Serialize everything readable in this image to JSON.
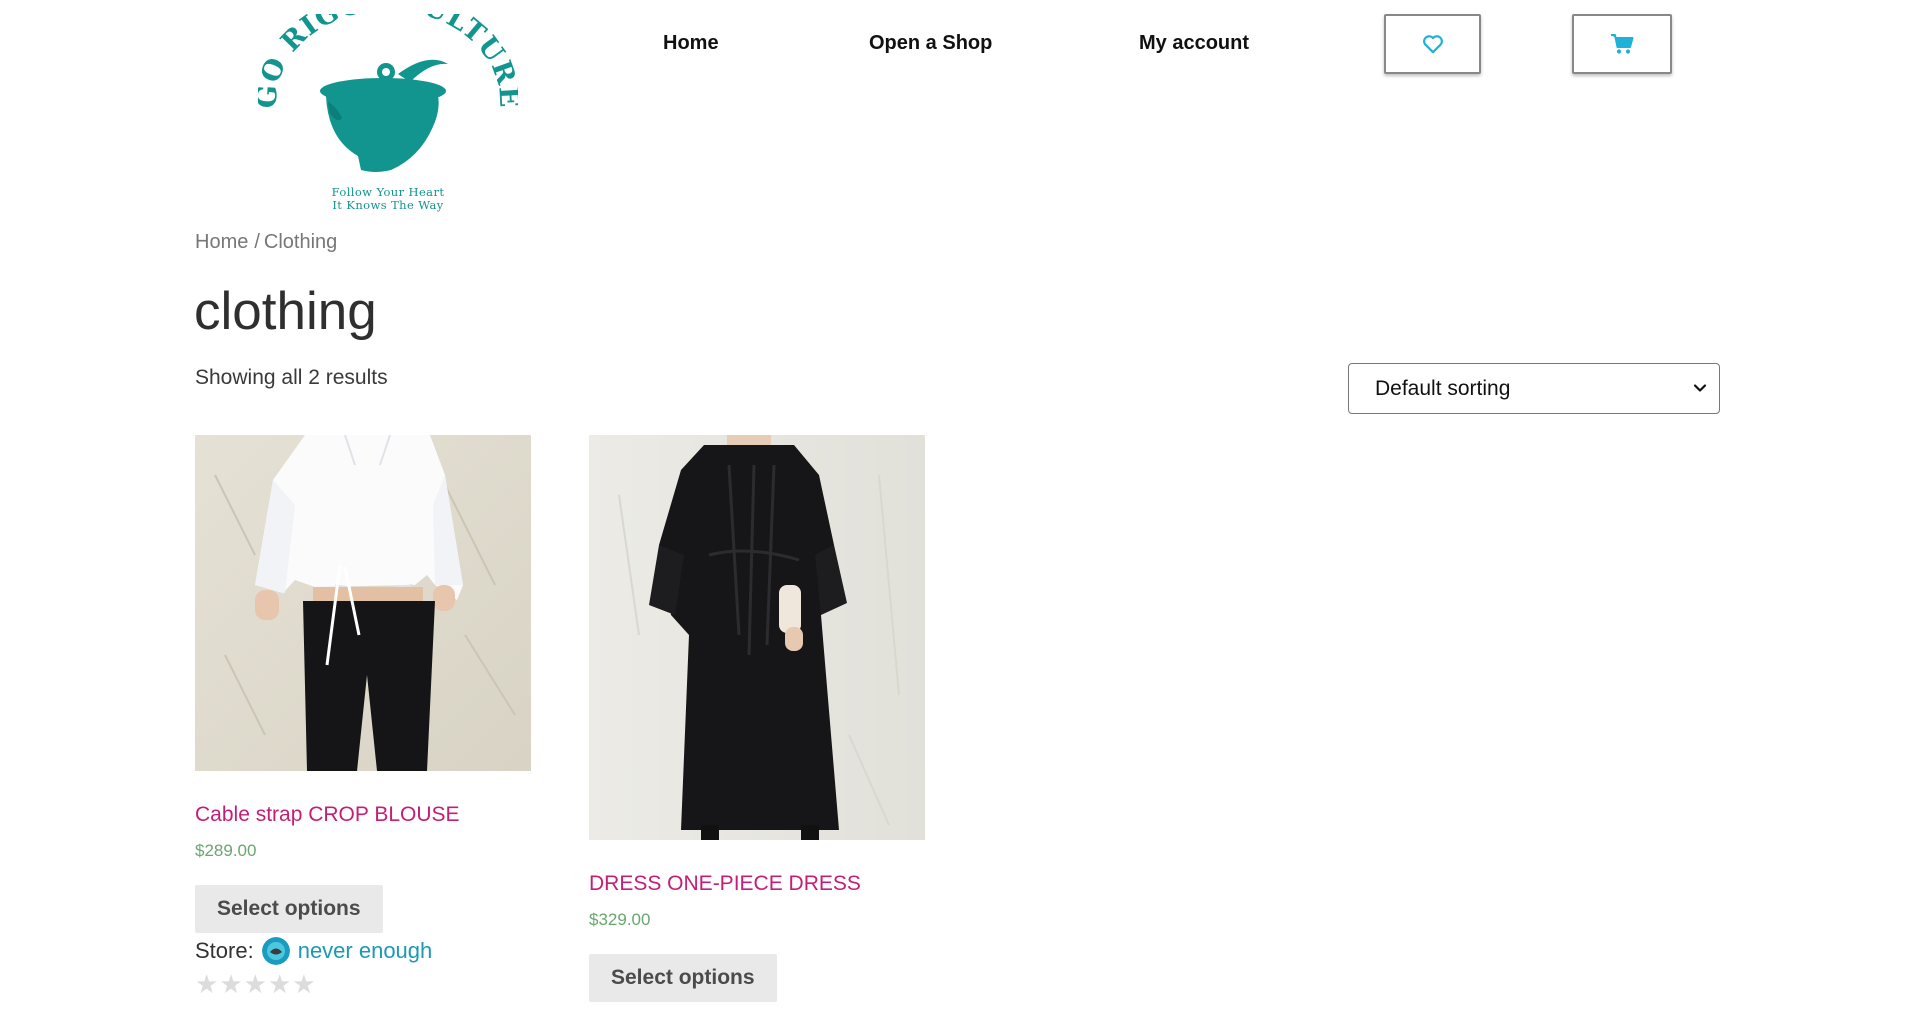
{
  "brand": {
    "logo_name": "GO RIGOR CULTURE",
    "tagline_1": "Follow Your Heart",
    "tagline_2": "It Knows The Way",
    "color": "#12948f"
  },
  "nav": {
    "items": [
      {
        "label": "Home"
      },
      {
        "label": "Open a Shop"
      },
      {
        "label": "My account"
      }
    ],
    "wishlist_icon": "heart-icon",
    "cart_icon": "cart-icon",
    "icon_color": "#1fb2d8"
  },
  "breadcrumb": {
    "home": "Home",
    "separator": "/",
    "current": "Clothing"
  },
  "page": {
    "title": "clothing",
    "result_count": "Showing all 2 results"
  },
  "sorting": {
    "selected": "Default sorting"
  },
  "products": [
    {
      "title": "Cable strap CROP BLOUSE",
      "price": "$289.00",
      "button": "Select options",
      "store_label": "Store:",
      "store_name": "never enough",
      "rating": 0,
      "image": "white-crop-blouse-photo"
    },
    {
      "title": "DRESS ONE-PIECE DRESS",
      "price": "$329.00",
      "button": "Select options",
      "image": "black-dress-photo"
    }
  ],
  "colors": {
    "product_title": "#c41e78",
    "price": "#6aa66f",
    "store_link": "#1b9ab3",
    "button_bg": "#e9e9e9"
  }
}
